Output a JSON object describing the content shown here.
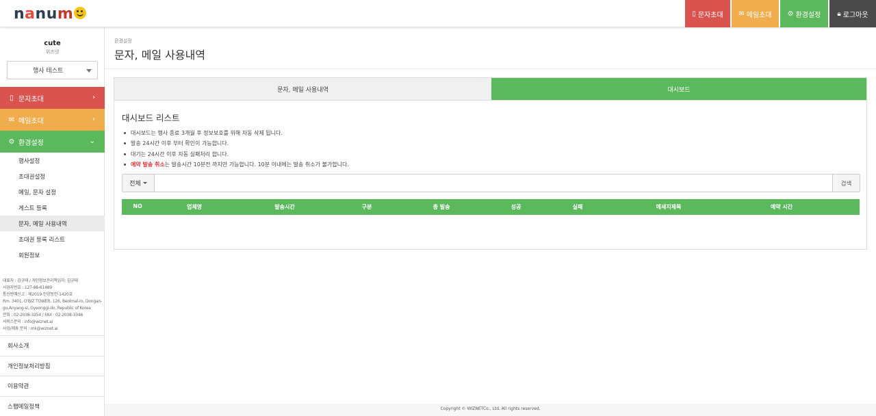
{
  "topbar": {
    "logo": {
      "letters": [
        "n",
        "a",
        "n",
        "u",
        "m"
      ]
    },
    "buttons": [
      {
        "icon": "mobile-icon",
        "label": "문자초대",
        "color": "#d9534f"
      },
      {
        "icon": "envelope-icon",
        "label": "메일초대",
        "color": "#f0ad4e"
      },
      {
        "icon": "gear-icon",
        "label": "환경설정",
        "color": "#5cb85c"
      },
      {
        "icon": "lock-icon",
        "label": "로그아웃",
        "color": "#4a4a4a"
      }
    ]
  },
  "sidebar": {
    "user_name": "cute",
    "user_org": "위즈넷",
    "event_select": {
      "selected": "행사 테스트"
    },
    "menu": [
      {
        "icon": "mobile-icon",
        "label": "문자초대",
        "color": "#d9534f"
      },
      {
        "icon": "envelope-icon",
        "label": "메일초대",
        "color": "#f0ad4e"
      },
      {
        "icon": "gear-icon",
        "label": "환경설정",
        "color": "#5cb85c",
        "expanded": true
      }
    ],
    "submenu": [
      {
        "label": "행사설정"
      },
      {
        "label": "초대권설정"
      },
      {
        "label": "메일, 문자 설정"
      },
      {
        "label": "게스트 등록"
      },
      {
        "label": "문자, 메일 사용내역",
        "active": true
      },
      {
        "label": "초대권 등록 리스트"
      },
      {
        "label": "회원정보"
      }
    ],
    "company_info": [
      "대표자 : 김규태 / 개인정보관리책임자: 김규태",
      "사업자번호 : 127-86-61489",
      "통신판매신고 : 제2019-안양동안-1420호",
      "Rm. 3401, O'BIZ TOWER, 126, Beolmal-ro, Dongan-gu,Anyang-si, Gyeonggi-do, Republic of Korea",
      "전화 : 02-2038-3354 / FAX : 02-2038-3346",
      "서비스문의 : info@wiznet.ai",
      "사업/제휴 문의 : mk@wiznet.ai"
    ],
    "footer_links": [
      "회사소개",
      "개인정보처리방침",
      "이용약관",
      "스팸메일정책"
    ]
  },
  "page": {
    "breadcrumb": "환경설정",
    "title": "문자, 메일 사용내역",
    "tabs": [
      {
        "label": "문자, 메일 사용내역",
        "active": false
      },
      {
        "label": "대시보드",
        "active": true
      }
    ],
    "section_title": "대시보드 리스트",
    "notes": [
      {
        "text": "대시보드는 행사 종료 3개월 후 정보보호를 위해 자동 삭제 됩니다."
      },
      {
        "text": "발송 24시간 이후 부터 확인이 가능합니다."
      },
      {
        "text": "대기는 24시간 이후 자동 실패처리 합니다."
      },
      {
        "highlight": "예약 발송 취소",
        "text": "는 발송시간 10분전 까지만 가능합니다. 10분 이내에는 발송 취소가 불가합니다."
      }
    ],
    "search": {
      "filter_label": "전체",
      "query": "",
      "button_label": "검색"
    },
    "table": {
      "columns": [
        "NO",
        "업체명",
        "발송시간",
        "구분",
        "총 발송",
        "성공",
        "실패",
        "메세지제목",
        "예약 시간"
      ],
      "rows": []
    }
  },
  "footer": {
    "copyright": "Copyright © WIZNETCo., Ltd. All rights reserved."
  },
  "colors": {
    "red": "#d9534f",
    "orange": "#f0ad4e",
    "green": "#5cb85c",
    "dark": "#4a4a4a",
    "highlight_red": "#e03131"
  }
}
